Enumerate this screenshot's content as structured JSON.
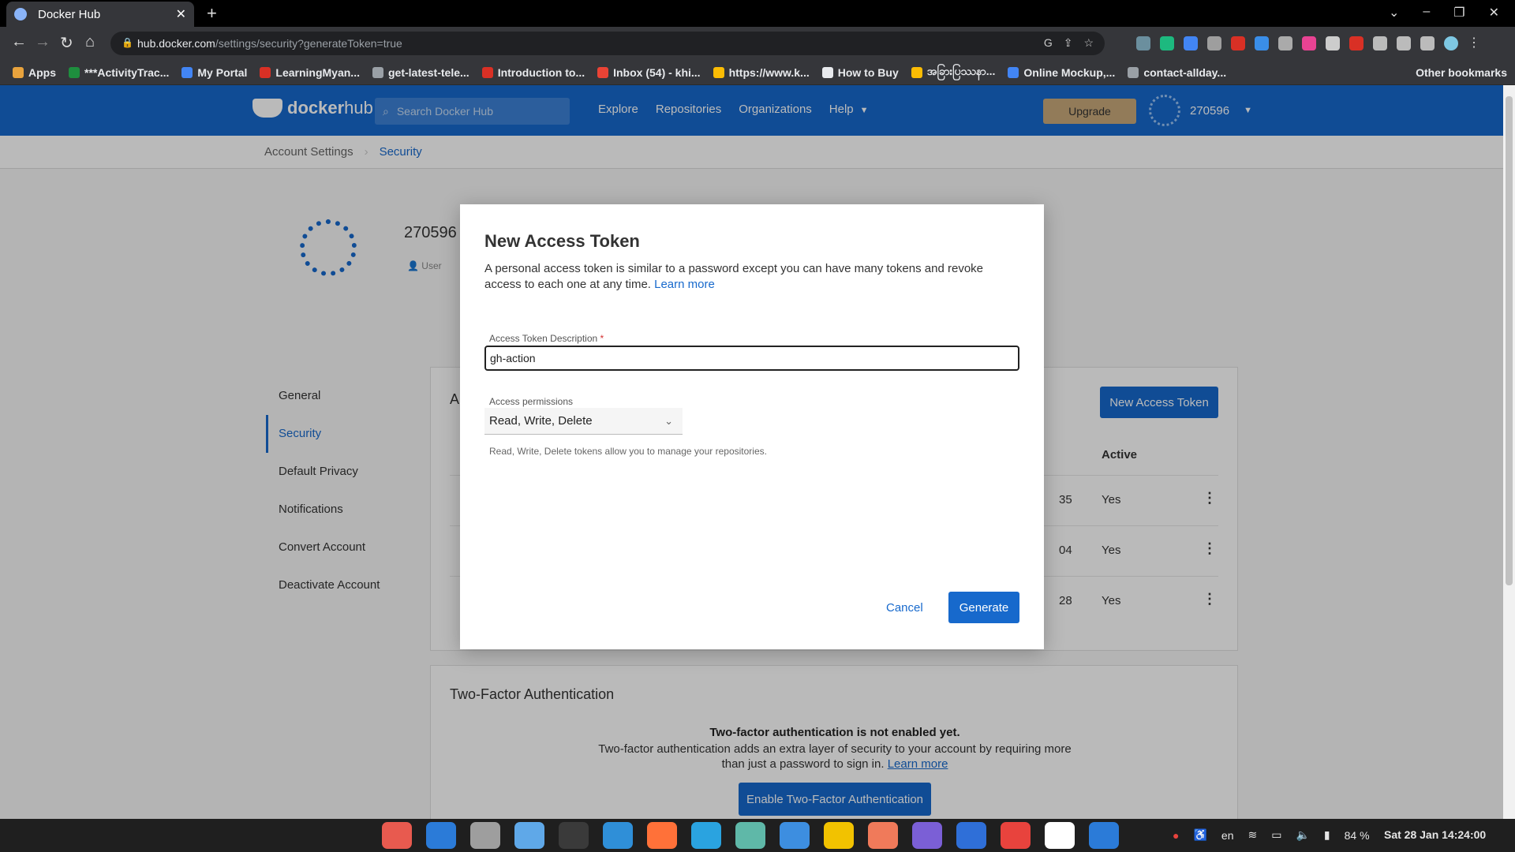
{
  "browser": {
    "tab_title": "Docker Hub",
    "tab_close": "✕",
    "new_tab": "+",
    "url_host": "hub.docker.com",
    "url_path": "/settings/security?generateToken=true",
    "bookmarks": [
      {
        "label": "Apps",
        "color": "#e8a33d"
      },
      {
        "label": "***ActivityTrac...",
        "color": "#1e8e3e"
      },
      {
        "label": "My Portal",
        "color": "#4285f4"
      },
      {
        "label": "LearningMyan...",
        "color": "#d93025"
      },
      {
        "label": "get-latest-tele...",
        "color": "#9aa0a6"
      },
      {
        "label": "Introduction to...",
        "color": "#d93025"
      },
      {
        "label": "Inbox (54) - khi...",
        "color": "#ea4335"
      },
      {
        "label": "https://www.k...",
        "color": "#fbbc04"
      },
      {
        "label": "How to Buy",
        "color": "#e8eaed"
      },
      {
        "label": "အခြားပြဿနာ...",
        "color": "#fbbc04"
      },
      {
        "label": "Online Mockup,...",
        "color": "#4285f4"
      },
      {
        "label": "contact-allday...",
        "color": "#9aa0a6"
      }
    ],
    "other_bookmarks": "Other bookmarks"
  },
  "header": {
    "logo_bold": "docker",
    "logo_light": "hub",
    "search_placeholder": "Search Docker Hub",
    "nav": [
      "Explore",
      "Repositories",
      "Organizations",
      "Help"
    ],
    "upgrade": "Upgrade",
    "username": "270596"
  },
  "breadcrumb": {
    "parent": "Account Settings",
    "current": "Security"
  },
  "profile": {
    "name": "270596",
    "role": "User"
  },
  "sidebar": {
    "items": [
      "General",
      "Security",
      "Default Privacy",
      "Notifications",
      "Convert Account",
      "Deactivate Account"
    ],
    "active": "Security"
  },
  "tokens_card": {
    "title_fragment": "A",
    "new_button": "New Access Token",
    "active_header": "Active",
    "rows": [
      {
        "created_fragment": "35",
        "active": "Yes"
      },
      {
        "created_fragment": "04",
        "active": "Yes"
      },
      {
        "created_fragment": "28",
        "active": "Yes"
      }
    ]
  },
  "two_factor": {
    "title": "Two-Factor Authentication",
    "heading": "Two-factor authentication is not enabled yet.",
    "text": "Two-factor authentication adds an extra layer of security to your account by requiring more than just a password to sign in.",
    "link": "Learn more",
    "button": "Enable Two-Factor Authentication"
  },
  "modal": {
    "title": "New Access Token",
    "description": "A personal access token is similar to a password except you can have many tokens and revoke access to each one at any time.",
    "learn_more": "Learn more",
    "field_label": "Access Token Description",
    "required_mark": "*",
    "field_value": "gh-action",
    "permissions_label": "Access permissions",
    "permissions_value": "Read, Write, Delete",
    "permissions_help": "Read, Write, Delete tokens allow you to manage your repositories.",
    "cancel": "Cancel",
    "generate": "Generate"
  },
  "taskbar": {
    "apps": [
      "#e85a4f",
      "#2b7bd8",
      "#9e9e9e",
      "#5fa8e8",
      "#3a3a3a",
      "#2f8fd8",
      "#ff7139",
      "#2aa3e0",
      "#5fb8a8",
      "#3d8ee0",
      "#f2c200",
      "#f07a5a",
      "#7b5fd6",
      "#2f6fd8",
      "#e8433d",
      "#ffffff",
      "#2b7bd8"
    ],
    "language": "en",
    "battery": "84 %",
    "clock": "Sat 28 Jan  14:24:00"
  }
}
